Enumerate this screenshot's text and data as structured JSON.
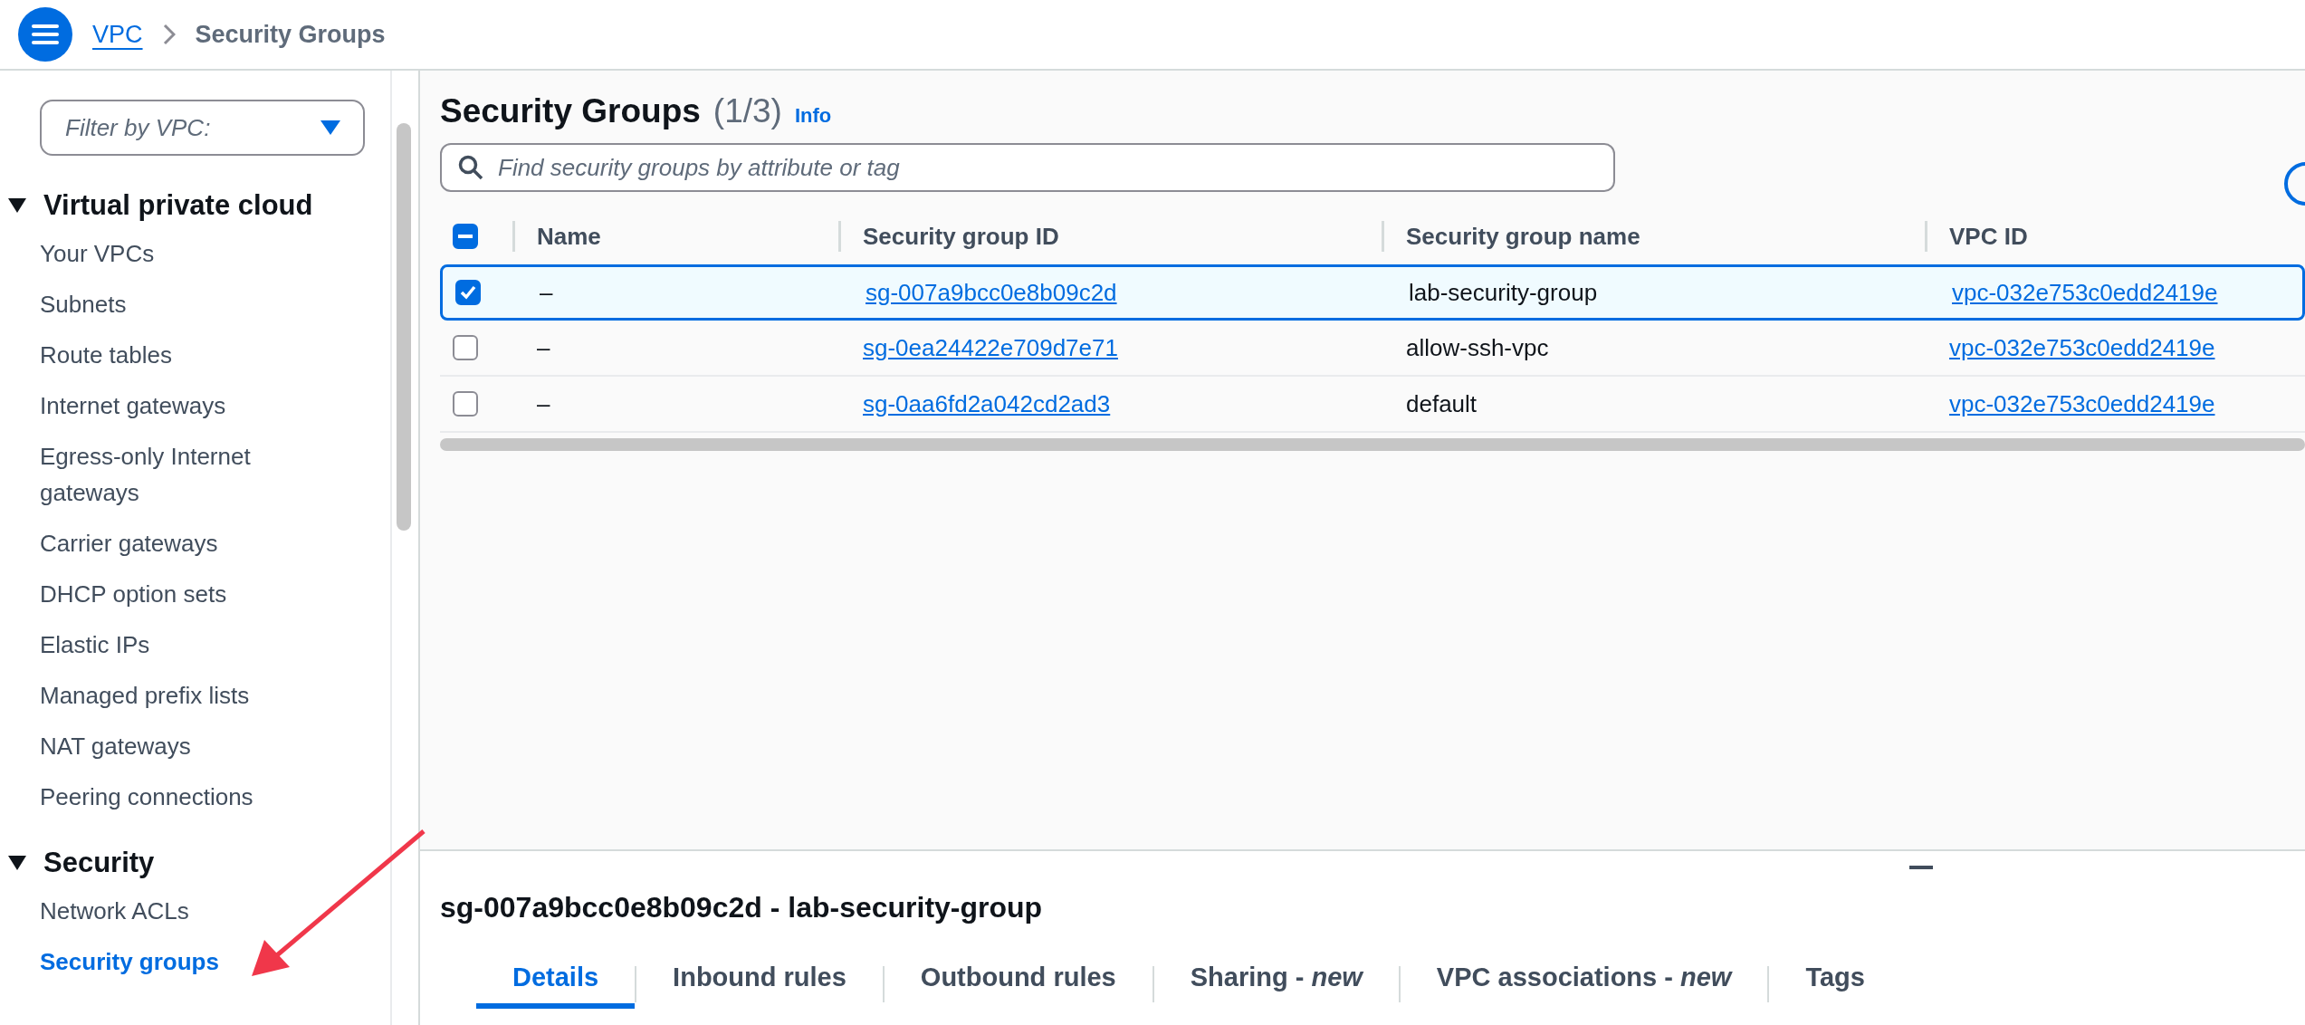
{
  "header": {
    "breadcrumbs": [
      {
        "label": "VPC",
        "kind": "link"
      },
      {
        "label": "Security Groups",
        "kind": "current"
      }
    ]
  },
  "sidebar": {
    "filter": {
      "placeholder": "Filter by VPC:"
    },
    "sections": [
      {
        "title": "Virtual private cloud",
        "expanded": true,
        "items": [
          {
            "label": "Your VPCs",
            "selected": false
          },
          {
            "label": "Subnets",
            "selected": false
          },
          {
            "label": "Route tables",
            "selected": false
          },
          {
            "label": "Internet gateways",
            "selected": false
          },
          {
            "label": "Egress-only Internet gateways",
            "selected": false
          },
          {
            "label": "Carrier gateways",
            "selected": false
          },
          {
            "label": "DHCP option sets",
            "selected": false
          },
          {
            "label": "Elastic IPs",
            "selected": false
          },
          {
            "label": "Managed prefix lists",
            "selected": false
          },
          {
            "label": "NAT gateways",
            "selected": false
          },
          {
            "label": "Peering connections",
            "selected": false
          }
        ]
      },
      {
        "title": "Security",
        "expanded": true,
        "items": [
          {
            "label": "Network ACLs",
            "selected": false
          },
          {
            "label": "Security groups",
            "selected": true
          }
        ]
      }
    ]
  },
  "main": {
    "title": "Security Groups",
    "count": "(1/3)",
    "info": "Info",
    "search": {
      "placeholder": "Find security groups by attribute or tag"
    },
    "table": {
      "select_all_partial": true,
      "columns": [
        "Name",
        "Security group ID",
        "Security group name",
        "VPC ID"
      ],
      "rows": [
        {
          "selected": true,
          "name": "–",
          "group_id": "sg-007a9bcc0e8b09c2d",
          "group_name": "lab-security-group",
          "vpc_id": "vpc-032e753c0edd2419e"
        },
        {
          "selected": false,
          "name": "–",
          "group_id": "sg-0ea24422e709d7e71",
          "group_name": "allow-ssh-vpc",
          "vpc_id": "vpc-032e753c0edd2419e"
        },
        {
          "selected": false,
          "name": "–",
          "group_id": "sg-0aa6fd2a042cd2ad3",
          "group_name": "default",
          "vpc_id": "vpc-032e753c0edd2419e"
        }
      ]
    }
  },
  "details": {
    "title": "sg-007a9bcc0e8b09c2d - lab-security-group",
    "tabs": [
      {
        "label": "Details",
        "selected": true
      },
      {
        "label": "Inbound rules",
        "selected": false
      },
      {
        "label": "Outbound rules",
        "selected": false
      },
      {
        "label": "Sharing - *new*",
        "selected": false
      },
      {
        "label": "VPC associations - *new*",
        "selected": false
      },
      {
        "label": "Tags",
        "selected": false
      }
    ]
  }
}
